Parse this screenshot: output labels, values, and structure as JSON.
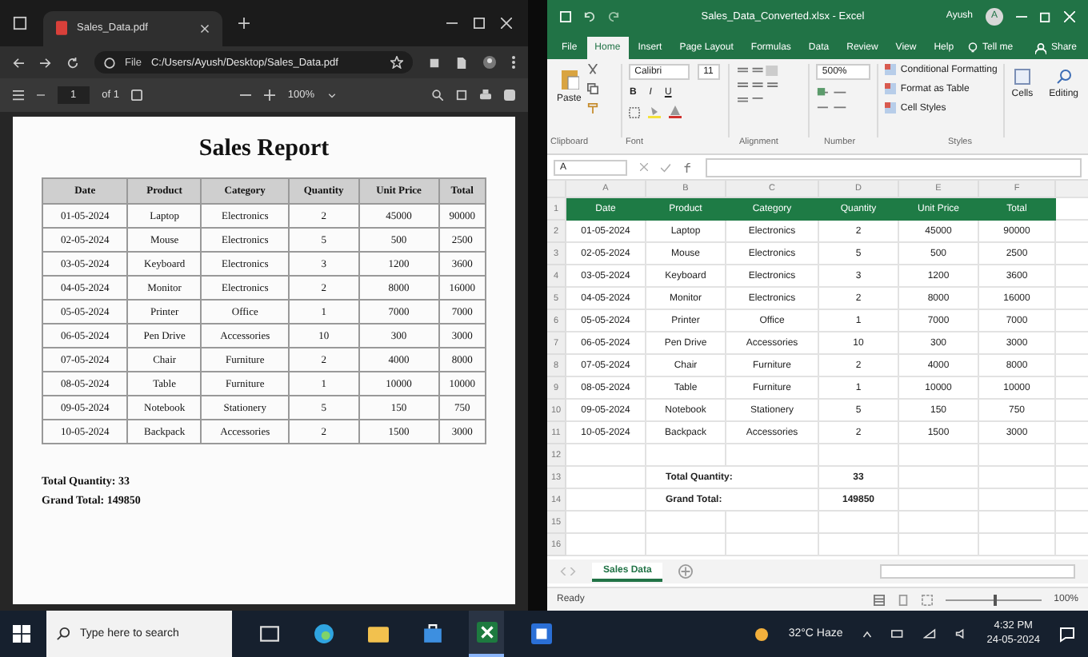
{
  "browser": {
    "tab_title": "Sales_Data.pdf",
    "address_label": "File",
    "address": "C:/Users/Ayush/Desktop/Sales_Data.pdf",
    "page": "1",
    "page_count": "of 1",
    "zoom": "100%"
  },
  "pdf": {
    "title": "Sales Report",
    "columns": [
      "Date",
      "Product",
      "Category",
      "Quantity",
      "Unit Price",
      "Total"
    ],
    "rows": [
      [
        "01-05-2024",
        "Laptop",
        "Electronics",
        "2",
        "45000",
        "90000"
      ],
      [
        "02-05-2024",
        "Mouse",
        "Electronics",
        "5",
        "500",
        "2500"
      ],
      [
        "03-05-2024",
        "Keyboard",
        "Electronics",
        "3",
        "1200",
        "3600"
      ],
      [
        "04-05-2024",
        "Monitor",
        "Electronics",
        "2",
        "8000",
        "16000"
      ],
      [
        "05-05-2024",
        "Printer",
        "Office",
        "1",
        "7000",
        "7000"
      ],
      [
        "06-05-2024",
        "Pen Drive",
        "Accessories",
        "10",
        "300",
        "3000"
      ],
      [
        "07-05-2024",
        "Chair",
        "Furniture",
        "2",
        "4000",
        "8000"
      ],
      [
        "08-05-2024",
        "Table",
        "Furniture",
        "1",
        "10000",
        "10000"
      ],
      [
        "09-05-2024",
        "Notebook",
        "Stationery",
        "5",
        "150",
        "750"
      ],
      [
        "10-05-2024",
        "Backpack",
        "Accessories",
        "2",
        "1500",
        "3000"
      ]
    ],
    "summary": [
      "Total Quantity: 33",
      "Grand Total: 149850"
    ]
  },
  "excel": {
    "title": "Sales_Data_Converted.xlsx - Excel",
    "user": "Ayush",
    "avatar": "A",
    "tabs": [
      {
        "label": "File",
        "selected": false
      },
      {
        "label": "Home",
        "selected": true
      },
      {
        "label": "Insert",
        "selected": false
      },
      {
        "label": "Page Layout",
        "selected": false
      },
      {
        "label": "Formulas",
        "selected": false
      },
      {
        "label": "Data",
        "selected": false
      },
      {
        "label": "Review",
        "selected": false
      },
      {
        "label": "View",
        "selected": false
      },
      {
        "label": "Help",
        "selected": false
      }
    ],
    "tell_me": "Tell me",
    "share": "Share",
    "ribbon": {
      "paste": "Paste",
      "font": "Calibri",
      "font_size": "11",
      "font_buttons": [
        "B",
        "I",
        "U"
      ],
      "number_format": "500%",
      "styles": [
        "Conditional Formatting",
        "Format as Table",
        "Cell Styles"
      ],
      "cells": "Cells",
      "editing": "Editing",
      "groups": [
        "Clipboard",
        "Font",
        "Alignment",
        "Number",
        "Styles"
      ]
    },
    "name_box": "A",
    "column_letters": [
      "A",
      "B",
      "C",
      "D",
      "E",
      "F"
    ],
    "rows": [
      {
        "number": "1",
        "kind": "header",
        "cells": [
          "Date",
          "Product",
          "Category",
          "Quantity",
          "Unit Price",
          "Total"
        ]
      },
      {
        "number": "2",
        "kind": "data",
        "cells": [
          "01-05-2024",
          "Laptop",
          "Electronics",
          "2",
          "45000",
          "90000"
        ]
      },
      {
        "number": "3",
        "kind": "data",
        "cells": [
          "02-05-2024",
          "Mouse",
          "Electronics",
          "5",
          "500",
          "2500"
        ]
      },
      {
        "number": "4",
        "kind": "data",
        "cells": [
          "03-05-2024",
          "Keyboard",
          "Electronics",
          "3",
          "1200",
          "3600"
        ]
      },
      {
        "number": "5",
        "kind": "data",
        "cells": [
          "04-05-2024",
          "Monitor",
          "Electronics",
          "2",
          "8000",
          "16000"
        ]
      },
      {
        "number": "6",
        "kind": "data",
        "cells": [
          "05-05-2024",
          "Printer",
          "Office",
          "1",
          "7000",
          "7000"
        ]
      },
      {
        "number": "7",
        "kind": "data",
        "cells": [
          "06-05-2024",
          "Pen Drive",
          "Accessories",
          "10",
          "300",
          "3000"
        ]
      },
      {
        "number": "8",
        "kind": "data",
        "cells": [
          "07-05-2024",
          "Chair",
          "Furniture",
          "2",
          "4000",
          "8000"
        ]
      },
      {
        "number": "9",
        "kind": "data",
        "cells": [
          "08-05-2024",
          "Table",
          "Furniture",
          "1",
          "10000",
          "10000"
        ]
      },
      {
        "number": "10",
        "kind": "data",
        "cells": [
          "09-05-2024",
          "Notebook",
          "Stationery",
          "5",
          "150",
          "750"
        ]
      },
      {
        "number": "11",
        "kind": "data",
        "cells": [
          "10-05-2024",
          "Backpack",
          "Accessories",
          "2",
          "1500",
          "3000"
        ]
      },
      {
        "number": "12",
        "kind": "empty"
      },
      {
        "number": "13",
        "kind": "summary",
        "label": "Total Quantity:",
        "value": "33"
      },
      {
        "number": "14",
        "kind": "summary",
        "label": "Grand Total:",
        "value": "149850"
      },
      {
        "number": "15",
        "kind": "empty"
      },
      {
        "number": "16",
        "kind": "empty"
      }
    ],
    "sheet_tab": "Sales Data",
    "status": "Ready",
    "zoom": "100%",
    "zoom_slider": {
      "level": 0.5
    }
  },
  "taskbar": {
    "search_placeholder": "Type here to search",
    "apps": [
      {
        "kind": "task-view",
        "selected": false
      },
      {
        "kind": "edge",
        "selected": false
      },
      {
        "kind": "explorer",
        "selected": false
      },
      {
        "kind": "store",
        "selected": false
      },
      {
        "kind": "excel",
        "selected": true
      },
      {
        "kind": "outlook",
        "selected": false
      }
    ],
    "weather": "32°C Haze",
    "time": "4:32 PM",
    "date": "24-05-2024"
  }
}
